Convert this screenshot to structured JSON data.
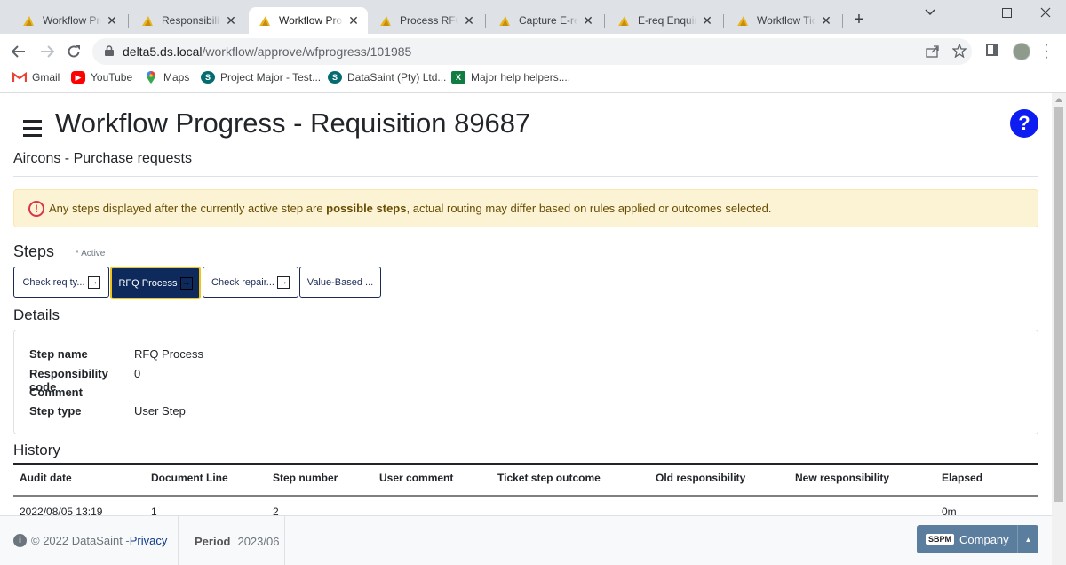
{
  "browser": {
    "tabs": [
      {
        "title": "Workflow Prog",
        "favicon": "triangle-icon"
      },
      {
        "title": "Responsibility",
        "favicon": "triangle-icon"
      },
      {
        "title": "Workflow Prog",
        "favicon": "triangle-icon",
        "active": true
      },
      {
        "title": "Process RFQ -",
        "favicon": "triangle-icon"
      },
      {
        "title": "Capture E-req",
        "favicon": "triangle-icon"
      },
      {
        "title": "E-req Enquiry",
        "favicon": "triangle-icon"
      },
      {
        "title": "Workflow Tick",
        "favicon": "triangle-icon"
      }
    ],
    "url_host": "delta5.ds.local",
    "url_path": "/workflow/approve/wfprogress/101985",
    "bookmarks": [
      {
        "label": "Gmail"
      },
      {
        "label": "YouTube"
      },
      {
        "label": "Maps"
      },
      {
        "label": "Project Major - Test..."
      },
      {
        "label": "DataSaint (Pty) Ltd..."
      },
      {
        "label": "Major help helpers...."
      }
    ]
  },
  "header": {
    "title": "Workflow Progress - Requisition 89687",
    "subtitle": "Aircons - Purchase requests",
    "help_label": "?"
  },
  "alert": {
    "prefix": "Any steps displayed after the currently active step are ",
    "bold": "possible steps",
    "suffix": ", actual routing may differ based on rules applied or outcomes selected."
  },
  "steps": {
    "title": "Steps",
    "active_note": "* Active",
    "items": [
      {
        "label": "Check req ty...",
        "has_go": true
      },
      {
        "label": "RFQ Process",
        "has_go": true,
        "active": true
      },
      {
        "label": "Check repair...",
        "has_go": true
      },
      {
        "label": "Value-Based ...",
        "has_go": false
      }
    ]
  },
  "details": {
    "title": "Details",
    "rows": [
      {
        "key": "Step name",
        "value": "RFQ Process"
      },
      {
        "key": "Responsibility code",
        "value": "0"
      },
      {
        "key": "Comment",
        "value": ""
      },
      {
        "key": "Step type",
        "value": "User Step"
      }
    ]
  },
  "history": {
    "title": "History",
    "columns": [
      "Audit date",
      "Document Line",
      "Step number",
      "User comment",
      "Ticket step outcome",
      "Old responsibility",
      "New responsibility",
      "Elapsed"
    ],
    "rows": [
      [
        "2022/08/05 13:19",
        "1",
        "2",
        "",
        "",
        "",
        "",
        "0m"
      ]
    ]
  },
  "footer": {
    "copyright": "© 2022 DataSaint - ",
    "privacy": "Privacy",
    "period_label": "Period",
    "period_value": "2023/06",
    "company_badge": "SBPM",
    "company_label": "Company"
  },
  "colors": {
    "primary_dark": "#0e2a5c",
    "active_border": "#f0c419",
    "help_blue": "#0d1cf0",
    "alert_bg": "#fcf3d4"
  }
}
